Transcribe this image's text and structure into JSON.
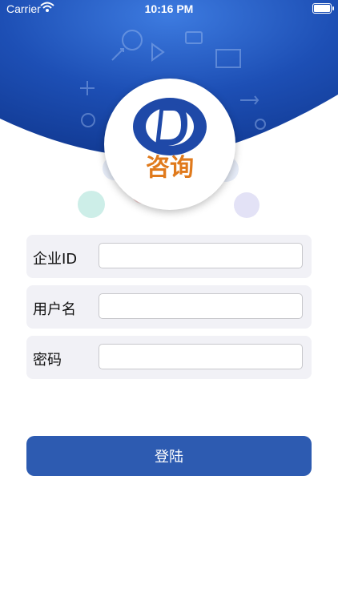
{
  "status_bar": {
    "carrier": "Carrier",
    "time": "10:16 PM"
  },
  "logo": {
    "letter": "D",
    "caption": "咨询"
  },
  "form": {
    "fields": [
      {
        "label": "企业ID",
        "value": ""
      },
      {
        "label": "用户名",
        "value": ""
      },
      {
        "label": "密码",
        "value": ""
      }
    ]
  },
  "login_button": {
    "label": "登陆"
  },
  "colors": {
    "header_blue": "#1f49a8",
    "button_blue": "#2d5bb1",
    "logo_orange": "#e07a1c",
    "field_bg": "#f1f1f6"
  }
}
